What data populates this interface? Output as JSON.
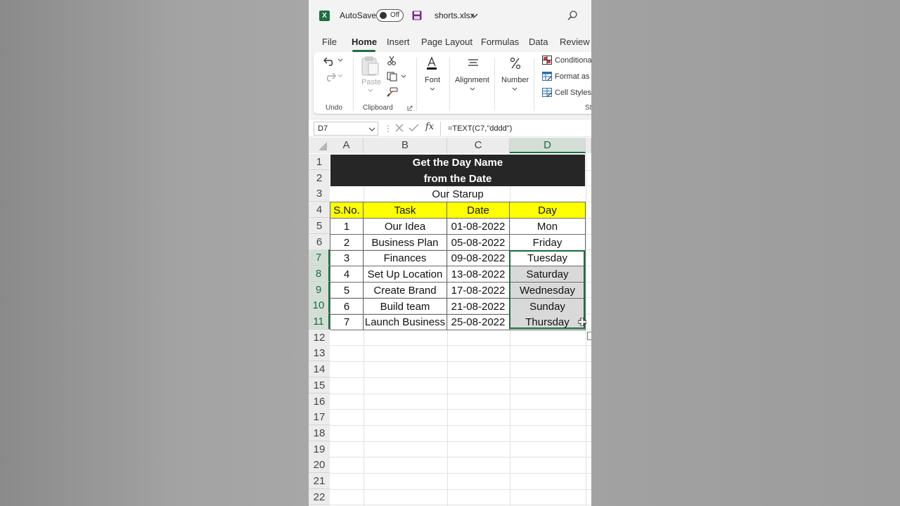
{
  "titlebar": {
    "autosave_label": "AutoSave",
    "autosave_state": "Off",
    "filename": "shorts.xlsx"
  },
  "tabs": [
    "File",
    "Home",
    "Insert",
    "Page Layout",
    "Formulas",
    "Data",
    "Review"
  ],
  "active_tab": "Home",
  "ribbon": {
    "undo_group": "Undo",
    "paste_label": "Paste",
    "clipboard_group": "Clipboard",
    "font_label": "Font",
    "alignment_label": "Alignment",
    "number_label": "Number",
    "conditional_label": "Conditional",
    "format_as_label": "Format as",
    "cell_styles_label": "Cell Styles",
    "styles_group_partial": "St"
  },
  "formula_bar": {
    "name_box": "D7",
    "fx": "fx",
    "formula": "=TEXT(C7,\"dddd\")"
  },
  "grid": {
    "columns": [
      "A",
      "B",
      "C",
      "D"
    ],
    "selected_column": "D",
    "rows": [
      "1",
      "2",
      "3",
      "4",
      "5",
      "6",
      "7",
      "8",
      "9",
      "10",
      "11",
      "12",
      "13",
      "14",
      "15",
      "16",
      "17",
      "18",
      "19",
      "20",
      "21",
      "22"
    ],
    "selected_rows": [
      "7",
      "8",
      "9",
      "10",
      "11"
    ]
  },
  "sheet": {
    "title_line1": "Get the Day Name",
    "title_line2": "from the Date",
    "subtitle": "Our Starup",
    "headers": [
      "S.No.",
      "Task",
      "Date",
      "Day"
    ],
    "records": [
      [
        "1",
        "Our Idea",
        "01-08-2022",
        "Mon"
      ],
      [
        "2",
        "Business Plan",
        "05-08-2022",
        "Friday"
      ],
      [
        "3",
        "Finances",
        "09-08-2022",
        "Tuesday"
      ],
      [
        "4",
        "Set Up Location",
        "13-08-2022",
        "Saturday"
      ],
      [
        "5",
        "Create Brand",
        "17-08-2022",
        "Wednesday"
      ],
      [
        "6",
        "Build team",
        "21-08-2022",
        "Sunday"
      ],
      [
        "7",
        "Launch Business",
        "25-08-2022",
        "Thursday"
      ]
    ]
  },
  "colors": {
    "excel_green": "#1d6f42",
    "title_fill": "#262626",
    "header_fill": "#ffff00",
    "selection_fill": "#d9d9d9"
  }
}
